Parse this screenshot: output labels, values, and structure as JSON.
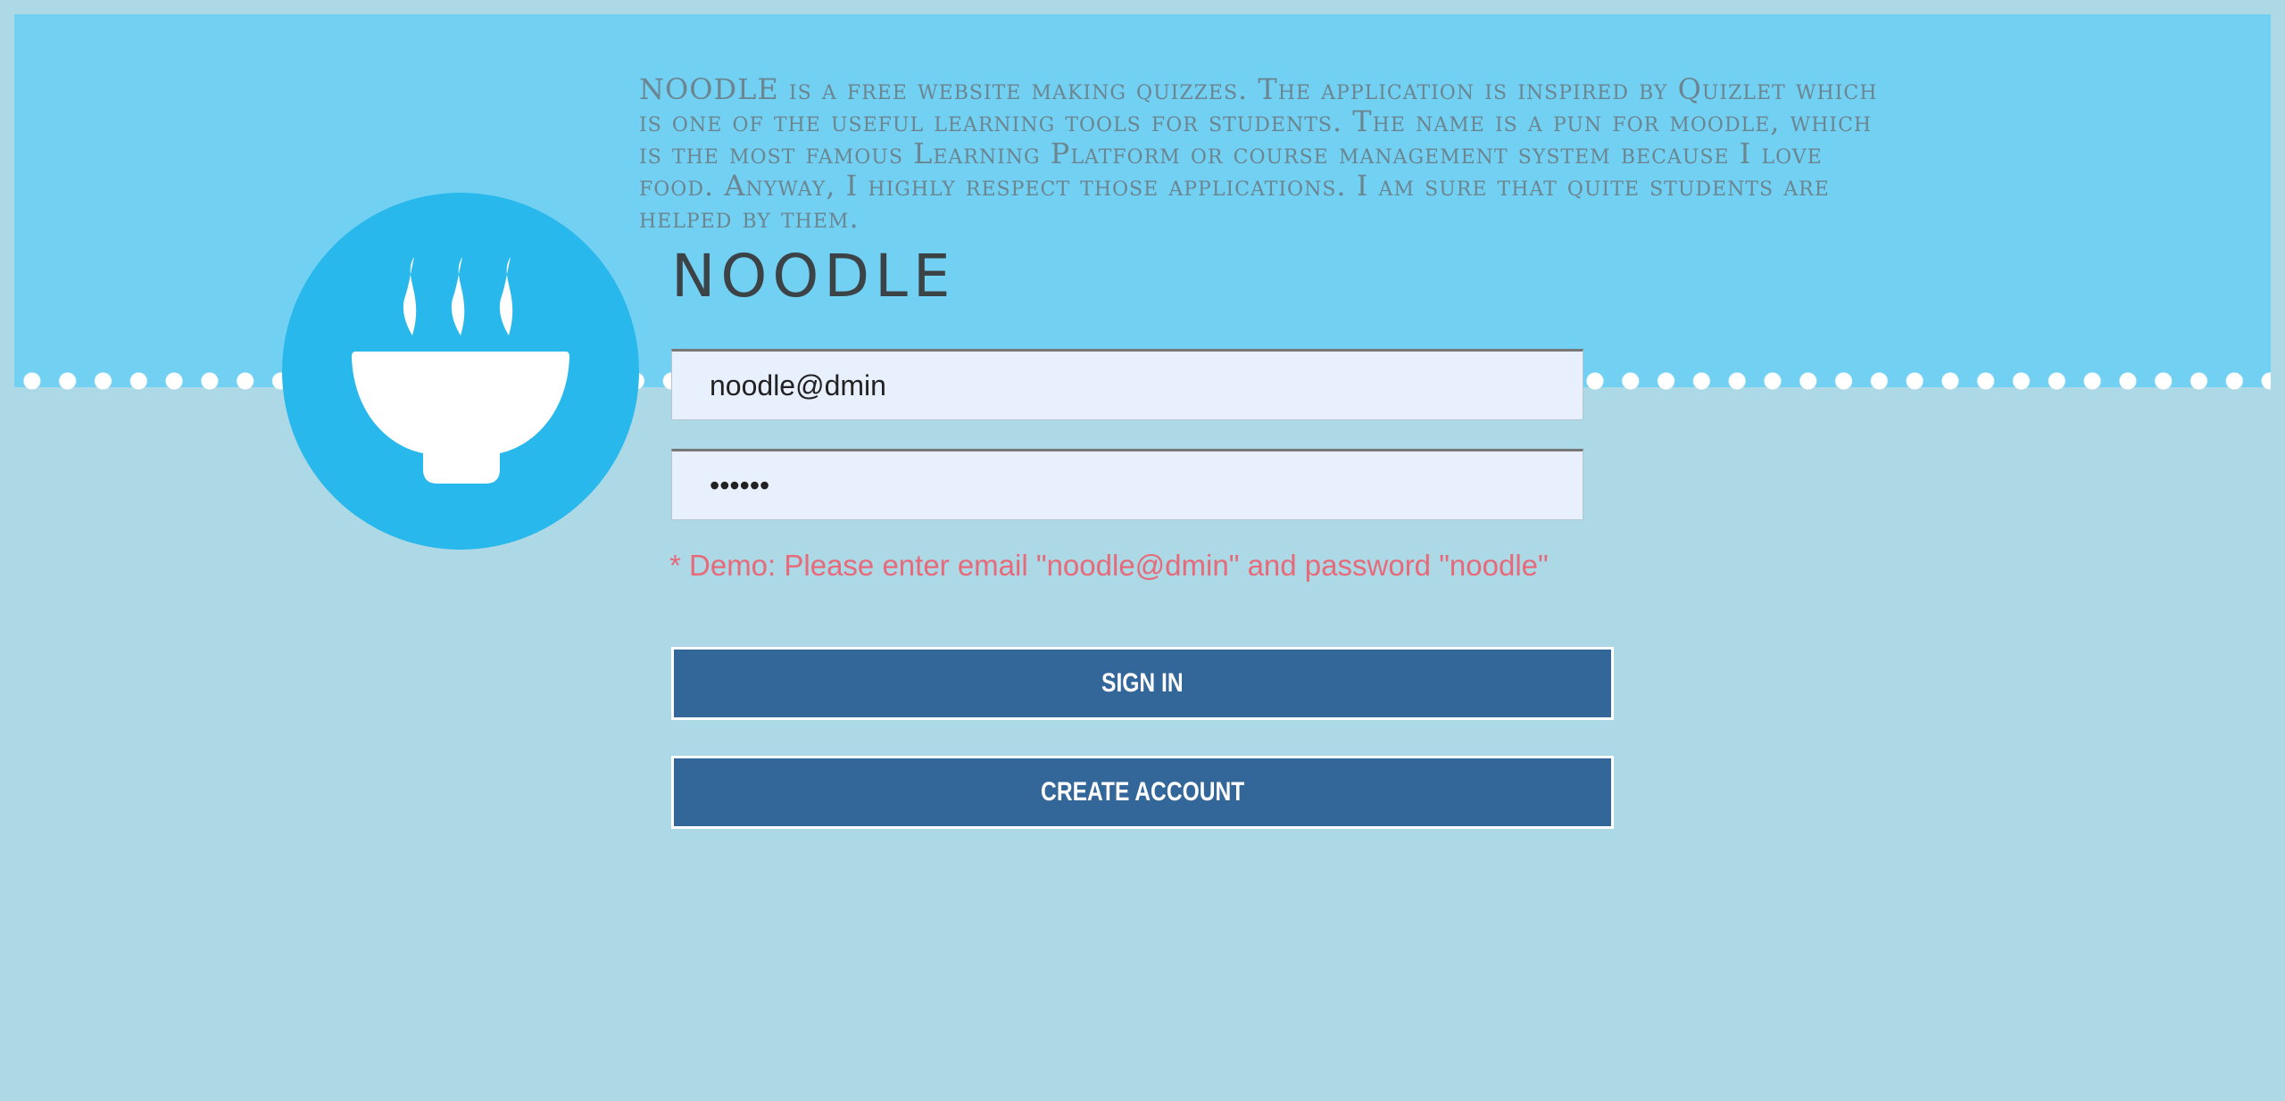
{
  "description": "NOODLE is a free website making quizzes. The application is inspired by Quizlet which is one of the useful learning tools for students. The name is a pun for moodle, which is the most famous Learning Platform or course management system because I love food. Anyway, I highly respect those applications. I am sure that quite students are helped by them.",
  "app_title": "NOODLE",
  "logo": {
    "icon": "steaming-bowl-icon",
    "circle_color": "#29b8ec"
  },
  "login_form": {
    "email_value": "noodle@dmin",
    "password_value": "noodle",
    "demo_note": "* Demo: Please enter email \"noodle@dmin\" and password \"noodle\"",
    "signin_label": "SIGN IN",
    "create_account_label": "CREATE ACCOUNT"
  },
  "colors": {
    "background": "#add8e6",
    "banner": "#72d0f2",
    "button": "#336699",
    "demo_note": "#e66a7a"
  }
}
